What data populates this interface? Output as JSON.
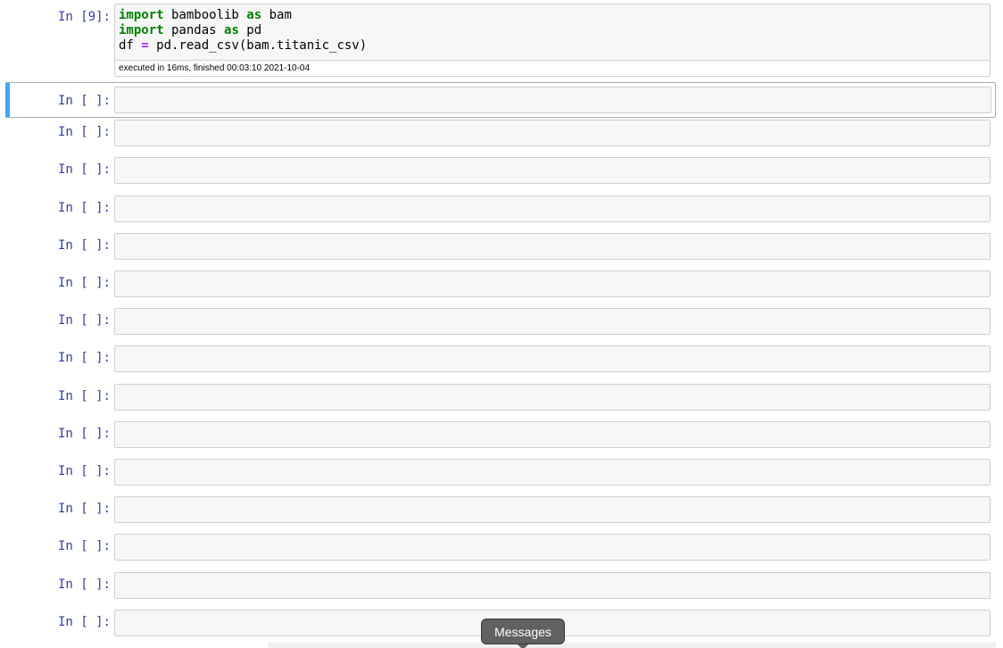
{
  "first_cell": {
    "prompt": "In [9]:",
    "code_lines": [
      [
        {
          "t": "import",
          "c": "kw"
        },
        {
          "t": " bamboolib "
        },
        {
          "t": "as",
          "c": "kw"
        },
        {
          "t": " bam"
        }
      ],
      [
        {
          "t": "import",
          "c": "kw"
        },
        {
          "t": " pandas "
        },
        {
          "t": "as",
          "c": "kw"
        },
        {
          "t": " pd"
        }
      ],
      [
        {
          "t": "df "
        },
        {
          "t": "=",
          "c": "op"
        },
        {
          "t": " pd.read_csv(bam.titanic_csv)"
        }
      ]
    ],
    "exec_info": "executed in 16ms, finished 00:03:10 2021-10-04"
  },
  "empty_prompt": "In [ ]:",
  "empty_cell_count": 15,
  "tooltip": {
    "label": "Messages"
  },
  "colors": {
    "accent": "#42a5f5",
    "prompt": "#303f9f",
    "keyword": "#008000",
    "operator": "#aa22ff"
  }
}
